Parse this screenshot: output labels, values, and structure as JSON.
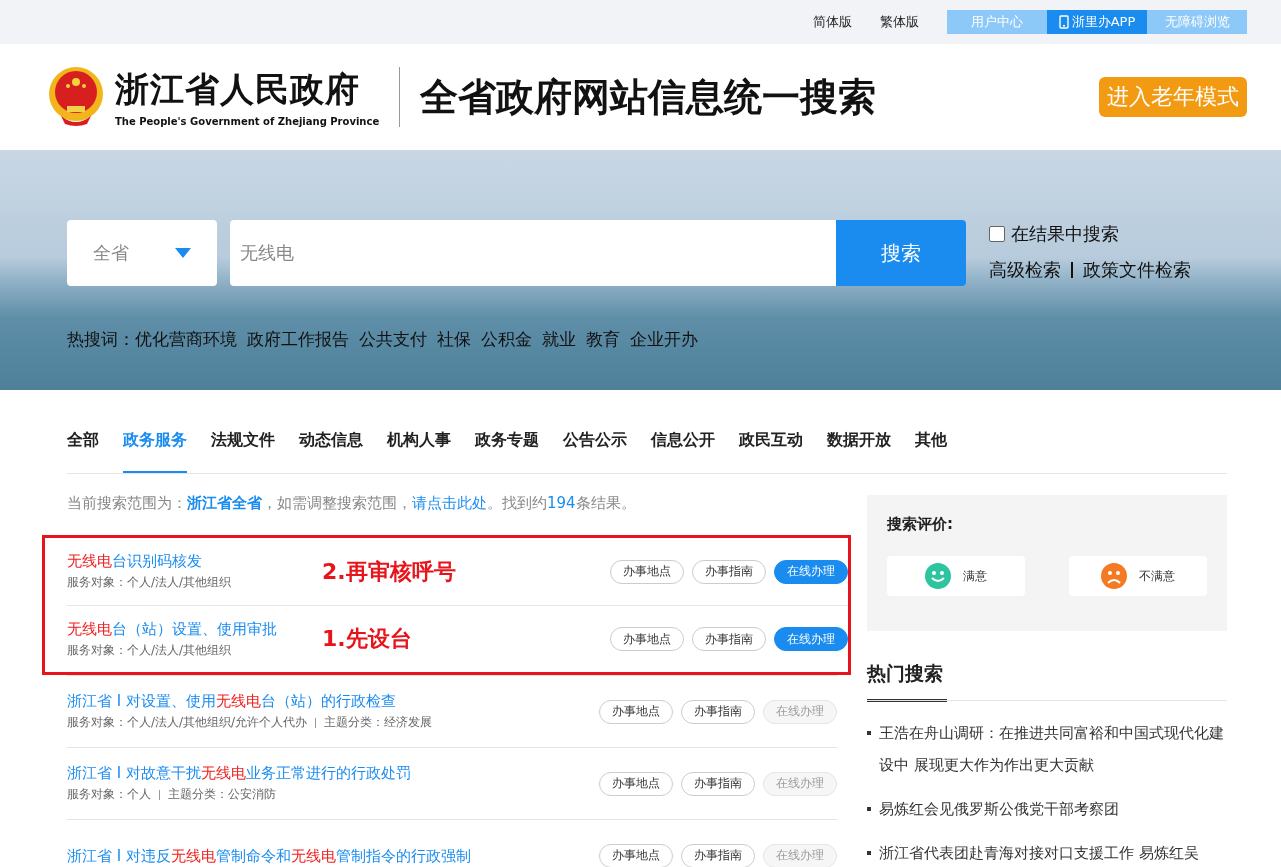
{
  "top_bar": {
    "links": [
      "简体版",
      "繁体版"
    ],
    "buttons": [
      {
        "label": "用户中心",
        "kind": "plain",
        "selected": false
      },
      {
        "label": "浙里办APP",
        "kind": "phone",
        "selected": true
      },
      {
        "label": "无障碍浏览",
        "kind": "plain",
        "selected": false
      }
    ]
  },
  "header": {
    "site_name": "浙江省人民政府",
    "site_name_en": "The People's Government of Zhejiang Province",
    "title": "全省政府网站信息统一搜索",
    "elder_mode": "进入老年模式"
  },
  "search": {
    "scope": "全省",
    "value": "无线电",
    "button": "搜索",
    "in_results": {
      "label": "在结果中搜索",
      "checked": false
    },
    "links": [
      "高级检索",
      "政策文件检索"
    ],
    "hot_label": "热搜词：",
    "hot_words": [
      "优化营商环境",
      "政府工作报告",
      "公共支付",
      "社保",
      "公积金",
      "就业",
      "教育",
      "企业开办"
    ]
  },
  "tabs": [
    {
      "label": "全部",
      "selected": false
    },
    {
      "label": "政务服务",
      "selected": true
    },
    {
      "label": "法规文件",
      "selected": false
    },
    {
      "label": "动态信息",
      "selected": false
    },
    {
      "label": "机构人事",
      "selected": false
    },
    {
      "label": "政务专题",
      "selected": false
    },
    {
      "label": "公告公示",
      "selected": false
    },
    {
      "label": "信息公开",
      "selected": false
    },
    {
      "label": "政民互动",
      "selected": false
    },
    {
      "label": "数据开放",
      "selected": false
    },
    {
      "label": "其他",
      "selected": false
    }
  ],
  "summary": {
    "prefix": "当前搜索范围为：",
    "scope": "浙江省全省",
    "middle": "，如需调整搜索范围，",
    "link": "请点击此处",
    "found": "。找到约",
    "count": "194",
    "suffix": "条结果。"
  },
  "highlighted_results": [
    {
      "title": [
        {
          "text": "无线电",
          "hit": true
        },
        {
          "text": "台识别码核发",
          "hit": false
        }
      ],
      "meta": [
        "服务对象：个人/法人/其他组织"
      ],
      "note": "2.再审核呼号",
      "buttons": [
        "办事地点",
        "办事指南",
        "在线办理"
      ],
      "online": true
    },
    {
      "title": [
        {
          "text": "无线电",
          "hit": true
        },
        {
          "text": "台（站）设置、使用审批",
          "hit": false
        }
      ],
      "meta": [
        "服务对象：个人/法人/其他组织"
      ],
      "note": "1.先设台",
      "buttons": [
        "办事地点",
        "办事指南",
        "在线办理"
      ],
      "online": true
    }
  ],
  "results": [
    {
      "title": [
        {
          "text": "浙江省 I 对设置、使用",
          "hit": false
        },
        {
          "text": "无线电",
          "hit": true
        },
        {
          "text": "台（站）的行政检查",
          "hit": false
        }
      ],
      "meta": [
        "服务对象：个人/法人/其他组织/允许个人代办",
        "主题分类：经济发展"
      ],
      "buttons": [
        "办事地点",
        "办事指南",
        "在线办理"
      ],
      "online": false
    },
    {
      "title": [
        {
          "text": "浙江省 I 对故意干扰",
          "hit": false
        },
        {
          "text": "无线电",
          "hit": true
        },
        {
          "text": "业务正常进行的行政处罚",
          "hit": false
        }
      ],
      "meta": [
        "服务对象：个人",
        "主题分类：公安消防"
      ],
      "buttons": [
        "办事地点",
        "办事指南",
        "在线办理"
      ],
      "online": false
    },
    {
      "title": [
        {
          "text": "浙江省 I 对违反",
          "hit": false
        },
        {
          "text": "无线电",
          "hit": true
        },
        {
          "text": "管制命令和",
          "hit": false
        },
        {
          "text": "无线电",
          "hit": true
        },
        {
          "text": "管制指令的行政强制",
          "hit": false
        }
      ],
      "buttons": [
        "办事地点",
        "办事指南",
        "在线办理"
      ],
      "online": false
    }
  ],
  "rating": {
    "title": "搜索评价:",
    "options": [
      {
        "label": "满意",
        "kind": "happy",
        "color": "#2ec4a0"
      },
      {
        "label": "不满意",
        "kind": "sad",
        "color": "#f57a24"
      }
    ]
  },
  "hot": {
    "title": "热门搜索",
    "items": [
      "王浩在舟山调研：在推进共同富裕和中国式现代化建设中 展现更大作为作出更大贡献",
      "易炼红会见俄罗斯公俄党干部考察团",
      "浙江省代表团赴青海对接对口支援工作 易炼红吴"
    ]
  }
}
